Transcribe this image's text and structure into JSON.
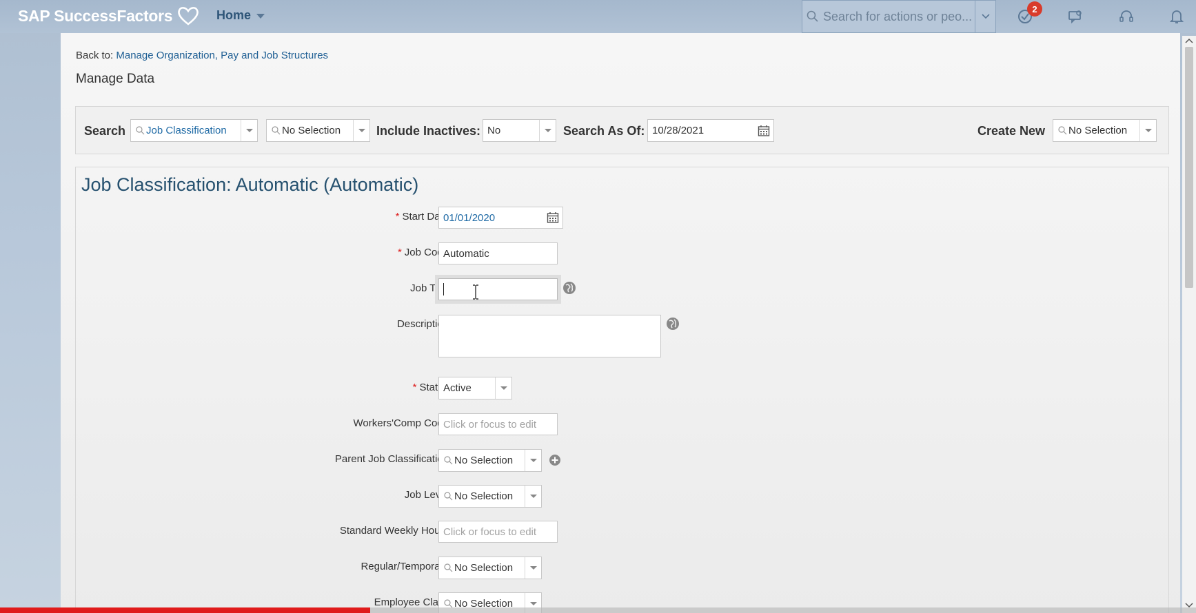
{
  "shell": {
    "brand": "SAP SuccessFactors",
    "home_label": "Home",
    "search_placeholder": "Search for actions or peo...",
    "notification_count": "2"
  },
  "breadcrumb": {
    "prefix": "Back to:",
    "link": "Manage Organization, Pay and Job Structures"
  },
  "page_title": "Manage Data",
  "search_bar": {
    "search_label": "Search",
    "search_object": "Job Classification",
    "search_item": "No Selection",
    "include_inactives_label": "Include Inactives:",
    "include_inactives_value": "No",
    "search_as_of_label": "Search As Of:",
    "search_as_of_value": "10/28/2021",
    "create_new_label": "Create New",
    "create_new_value": "No Selection"
  },
  "detail": {
    "title": "Job Classification: Automatic (Automatic)",
    "fields": {
      "start_date": {
        "label": "Start Date",
        "value": "01/01/2020"
      },
      "job_code": {
        "label": "Job Code",
        "value": "Automatic"
      },
      "job_title": {
        "label": "Job Title",
        "value": ""
      },
      "description": {
        "label": "Description",
        "value": ""
      },
      "status": {
        "label": "Status",
        "value": "Active"
      },
      "workers_comp": {
        "label": "Workers'Comp Code",
        "placeholder": "Click or focus to edit"
      },
      "parent_job": {
        "label": "Parent Job Classification",
        "value": "No Selection"
      },
      "job_level": {
        "label": "Job Level",
        "value": "No Selection"
      },
      "weekly_hours": {
        "label": "Standard Weekly Hours",
        "placeholder": "Click or focus to edit"
      },
      "regular_temp": {
        "label": "Regular/Temporary",
        "value": "No Selection"
      },
      "employee_class": {
        "label": "Employee Class",
        "value": "No Selection"
      }
    }
  },
  "colors": {
    "shell_bg": "#a5b8cd",
    "link": "#1f5f94",
    "title": "#26516f",
    "required": "#dd2222",
    "video_progress": "#e01b1b"
  }
}
